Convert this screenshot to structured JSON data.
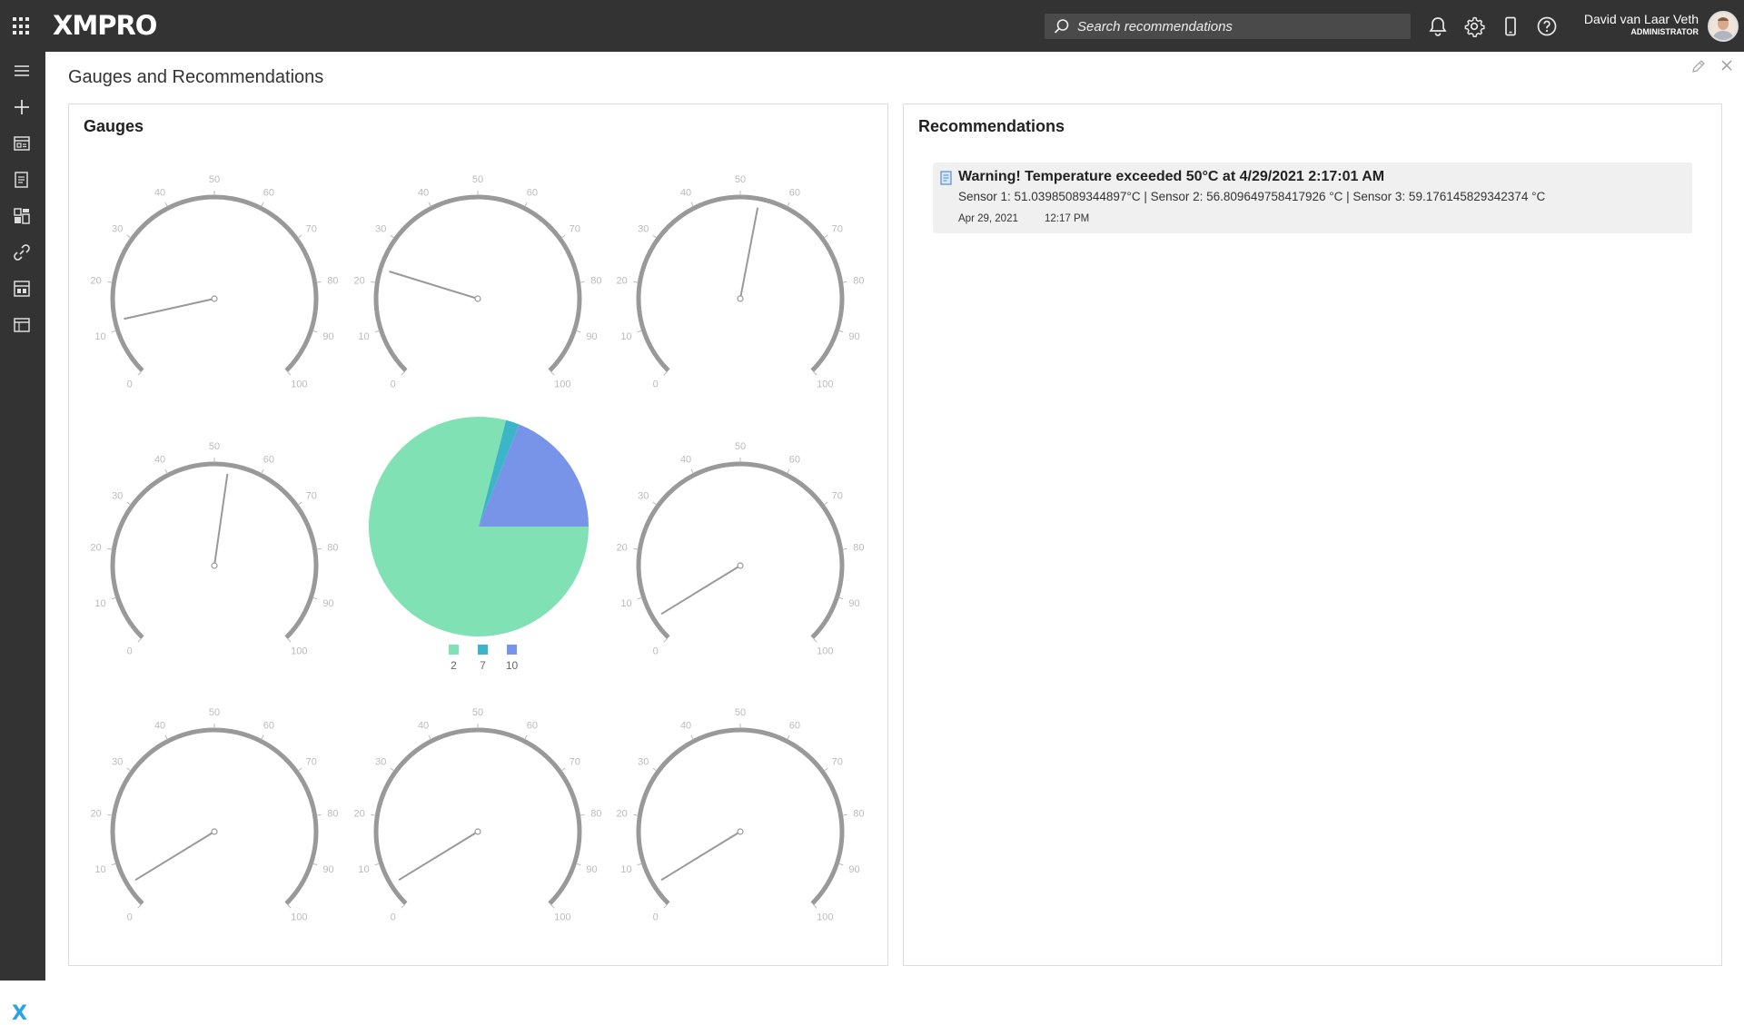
{
  "app": {
    "logo": "XMPRO",
    "search_placeholder": "Search recommendations",
    "user_name": "David van Laar Veth",
    "user_role": "ADMINISTRATOR"
  },
  "page": {
    "title": "Gauges and Recommendations"
  },
  "gauges_panel": {
    "title": "Gauges",
    "tick_labels": [
      "0",
      "10",
      "20",
      "30",
      "40",
      "50",
      "60",
      "70",
      "80",
      "90",
      "100"
    ],
    "gauges": [
      {
        "value": 12
      },
      {
        "value": 23
      },
      {
        "value": 54
      },
      {
        "value": 53
      },
      {
        "value": 5
      },
      {
        "value": 5
      },
      {
        "value": 5
      },
      {
        "value": 5
      }
    ]
  },
  "chart_data": {
    "type": "pie",
    "categories": [
      "2",
      "7",
      "10"
    ],
    "values": [
      0.79,
      0.02,
      0.19
    ],
    "colors": [
      "#80e2b4",
      "#3bb5c7",
      "#7894e8"
    ],
    "legend_position": "bottom"
  },
  "recommendations_panel": {
    "title": "Recommendations",
    "items": [
      {
        "title": "Warning! Temperature exceeded 50°C at 4/29/2021 2:17:01 AM",
        "description": "Sensor 1: 51.03985089344897°C | Sensor 2: 56.809649758417926 °C | Sensor 3: 59.176145829342374 °C",
        "date": "Apr 29, 2021",
        "time": "12:17 PM"
      }
    ]
  }
}
